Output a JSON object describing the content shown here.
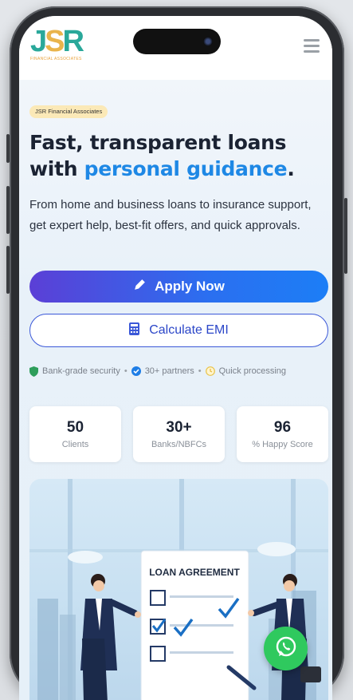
{
  "header": {
    "logo_letters": {
      "j": "J",
      "s": "S",
      "r": "R"
    },
    "logo_subtitle": "FINANCIAL ASSOCIATES"
  },
  "hero": {
    "badge": "JSR Financial Associates",
    "headline_plain": "Fast, transparent loans with ",
    "headline_accent": "personal guidance",
    "headline_end": ".",
    "description": "From home and business loans to insurance support, get expert help, best-fit offers, and quick approvals."
  },
  "buttons": {
    "apply": "Apply Now",
    "emi": "Calculate EMI"
  },
  "trust": {
    "security": "Bank-grade security",
    "partners": "30+ partners",
    "processing": "Quick processing",
    "separator": "•"
  },
  "stats": [
    {
      "value": "50",
      "label": "Clients"
    },
    {
      "value": "30+",
      "label": "Banks/NBFCs"
    },
    {
      "value": "96",
      "label": "% Happy Score"
    }
  ],
  "illustration": {
    "document_title": "LOAN AGREEMENT"
  },
  "colors": {
    "accent": "#1e88e5",
    "brand_teal": "#2aa89a",
    "brand_gold": "#e9b44c",
    "whatsapp": "#2fc95e"
  },
  "icons": [
    "menu-icon",
    "pencil-icon",
    "calculator-icon",
    "shield-icon",
    "check-circle-icon",
    "clock-icon",
    "whatsapp-icon"
  ]
}
